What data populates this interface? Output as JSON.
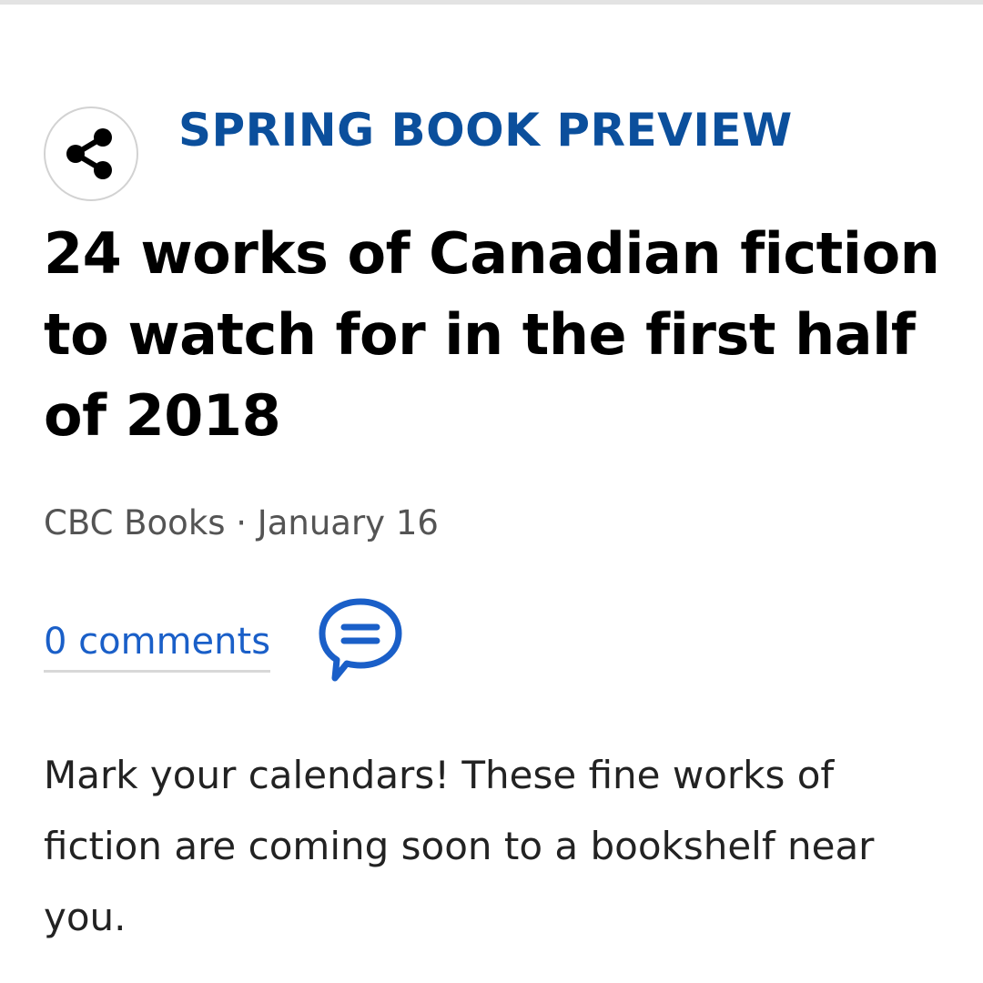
{
  "article": {
    "kicker": "SPRING BOOK PREVIEW",
    "headline": "24 works of Canadian fiction to watch for in the first half of 2018",
    "byline": "CBC Books · January 16",
    "comments_label": "0 comments",
    "intro": "Mark your calendars! These fine works of fiction are coming soon to a bookshelf near you."
  },
  "icons": {
    "share": "share-icon",
    "comments": "speech-bubble-icon"
  },
  "colors": {
    "kicker": "#0b4f9c",
    "link": "#1a5fc8",
    "headline": "#000000",
    "byline": "#545454",
    "body_text": "#222222"
  }
}
